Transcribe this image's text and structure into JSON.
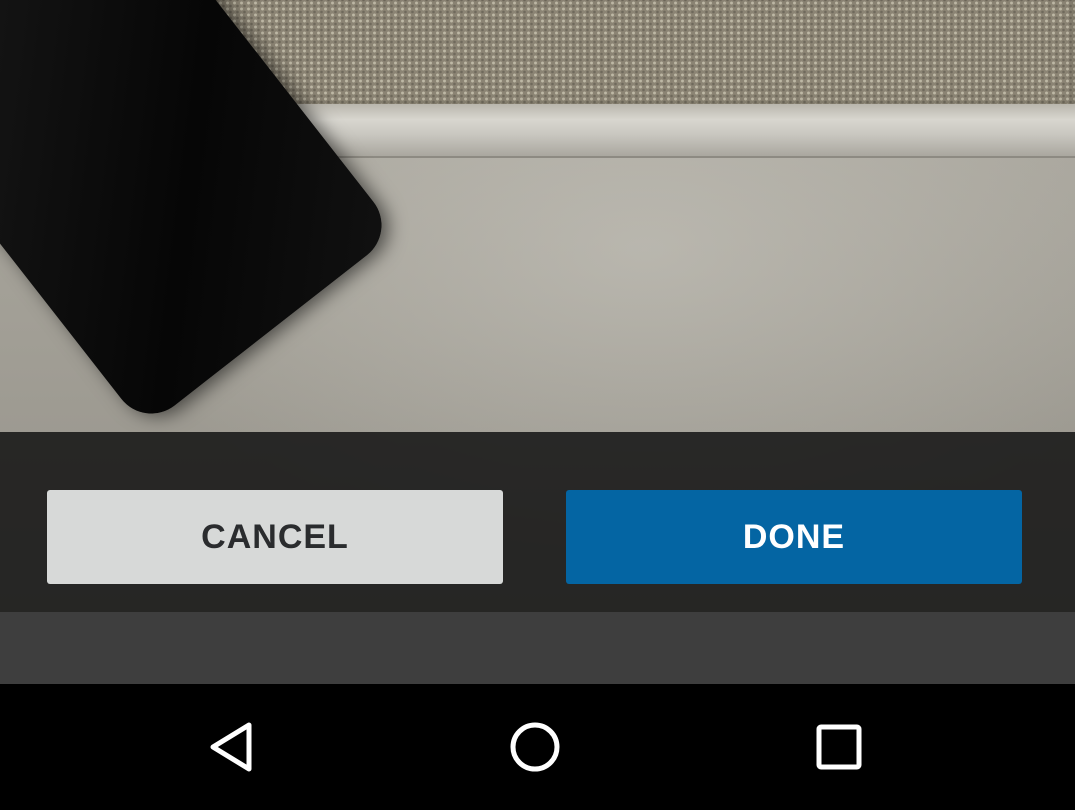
{
  "dialog": {
    "cancel_label": "CANCEL",
    "done_label": "DONE"
  },
  "colors": {
    "done_button": "#0465a3",
    "cancel_button": "#d7d9d8",
    "action_bar": "#1c1c1c",
    "gray_strip": "#3e3e3e",
    "nav_bar": "#000000",
    "nav_icon": "#ffffff"
  },
  "navigation": {
    "icons": [
      "back-triangle-icon",
      "home-circle-icon",
      "recents-square-icon"
    ]
  }
}
